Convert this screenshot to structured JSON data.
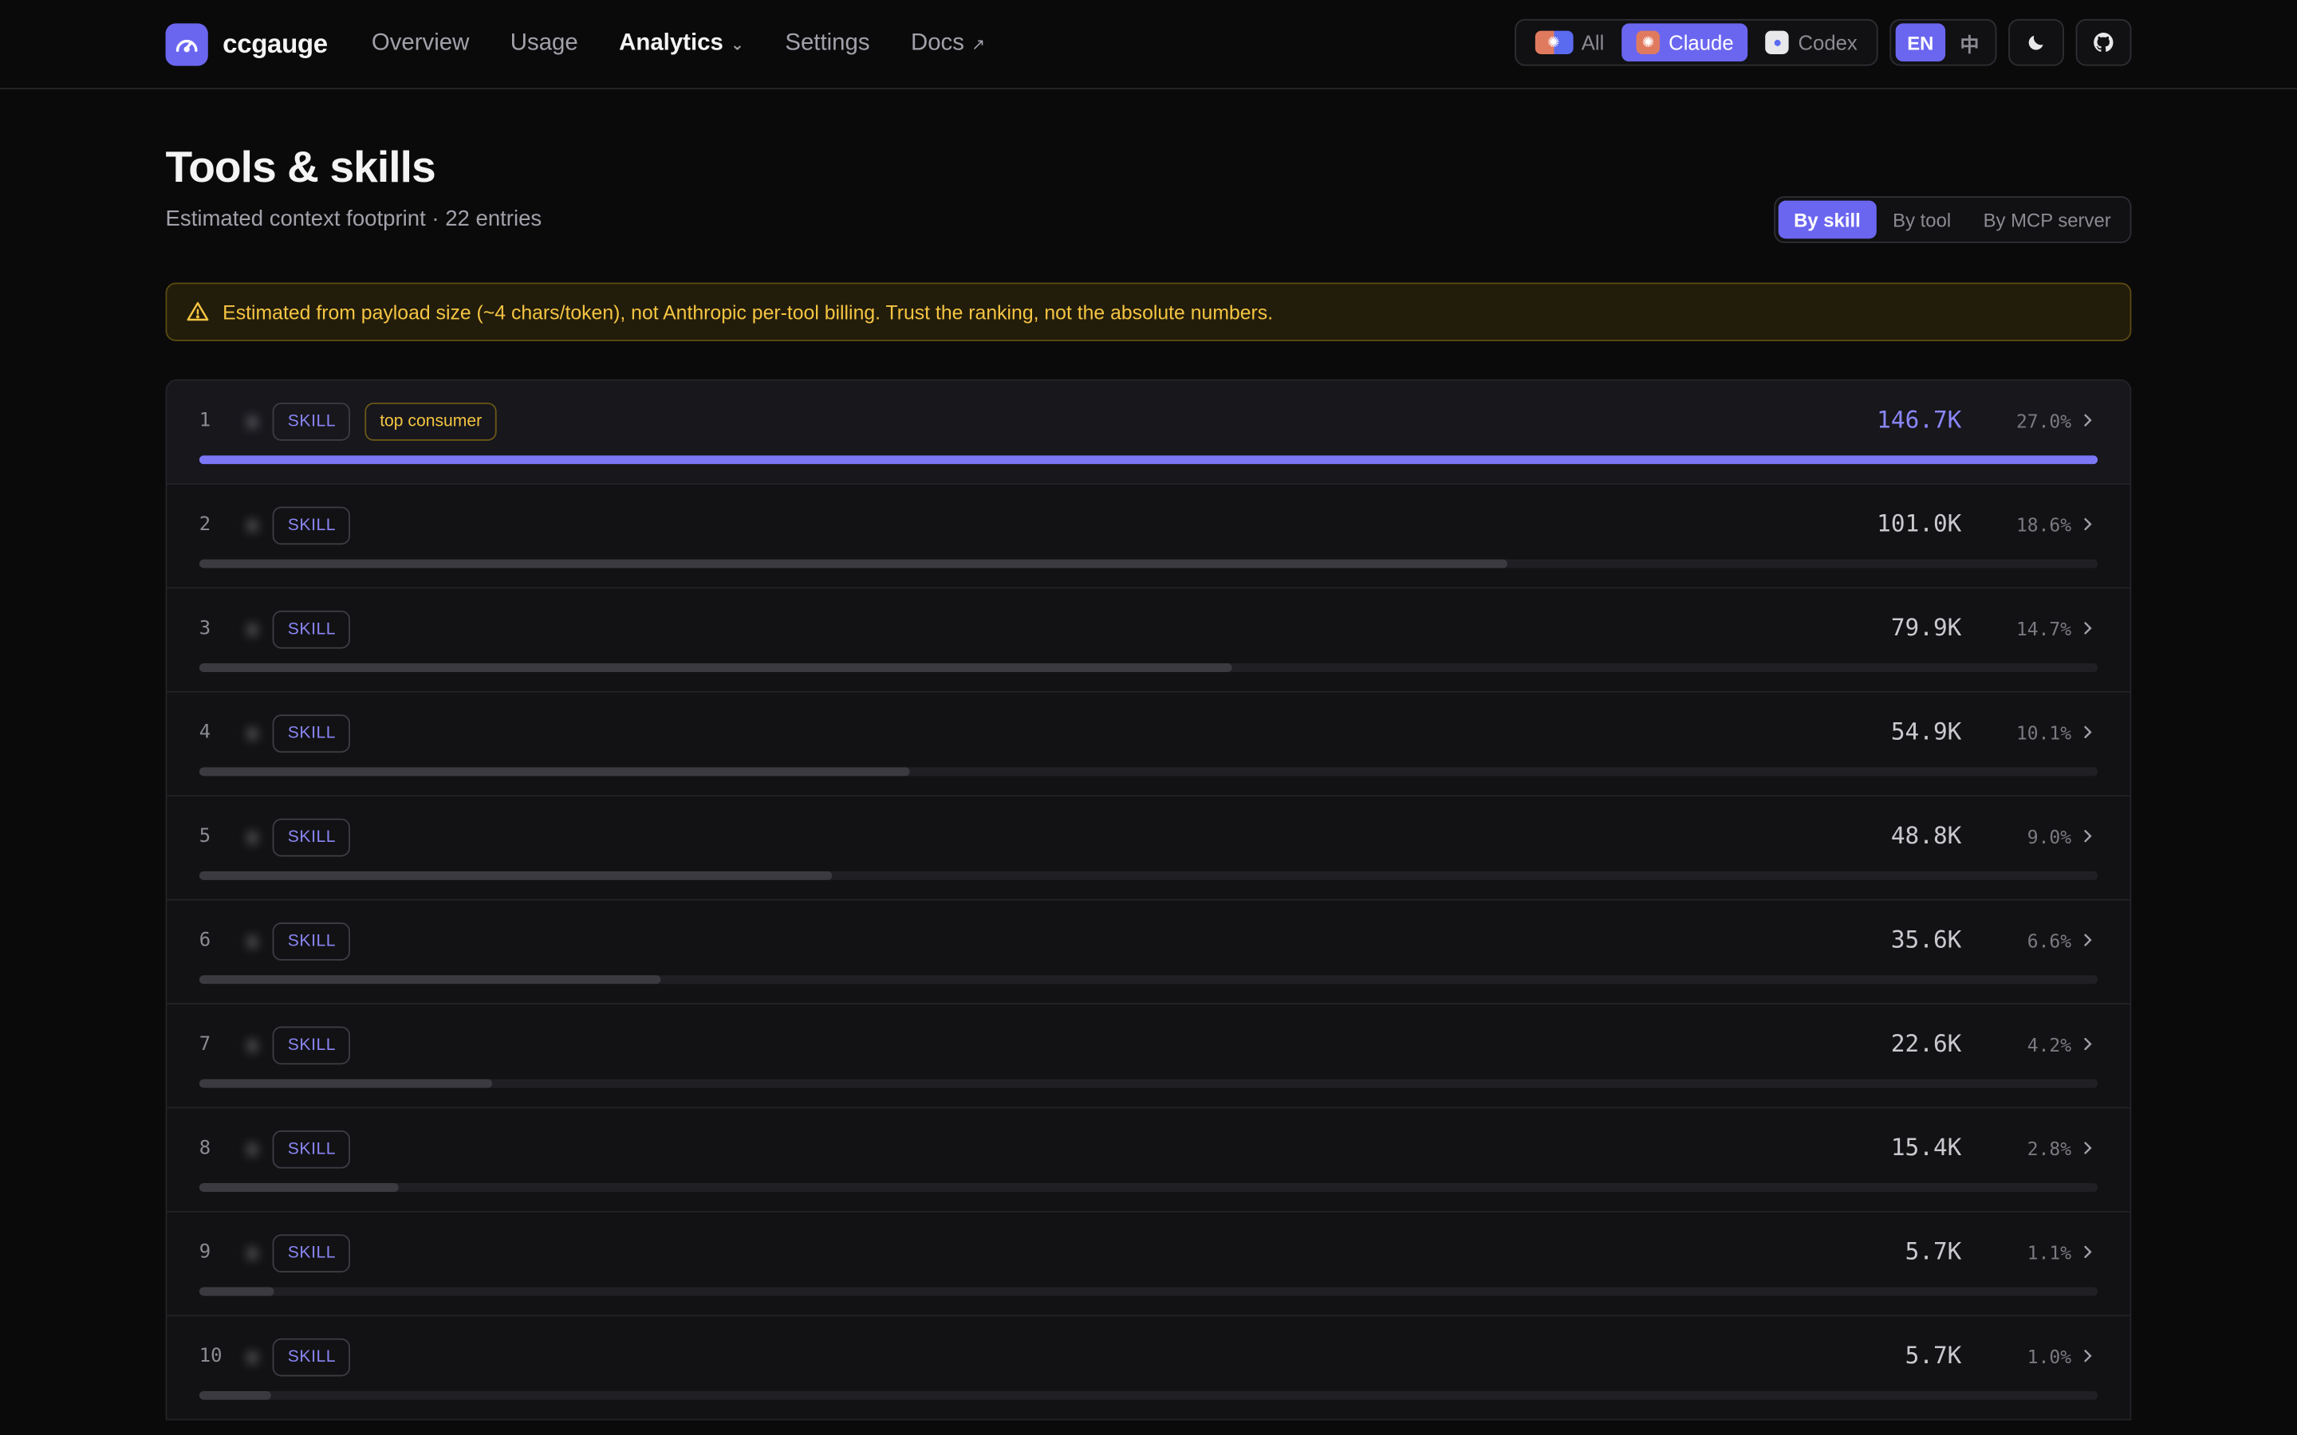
{
  "brand": {
    "name": "ccgauge"
  },
  "nav": [
    {
      "label": "Overview",
      "active": false,
      "glyph": ""
    },
    {
      "label": "Usage",
      "active": false,
      "glyph": ""
    },
    {
      "label": "Analytics",
      "active": true,
      "glyph": "⌄"
    },
    {
      "label": "Settings",
      "active": false,
      "glyph": ""
    },
    {
      "label": "Docs",
      "active": false,
      "glyph": "↗"
    }
  ],
  "source_filter": [
    {
      "label": "All",
      "icon": "all-sources-icon",
      "active": false
    },
    {
      "label": "Claude",
      "icon": "claude-icon",
      "active": true
    },
    {
      "label": "Codex",
      "icon": "codex-icon",
      "active": false
    }
  ],
  "language": [
    {
      "label": "EN",
      "active": true
    },
    {
      "label": "中",
      "active": false
    }
  ],
  "header_icons": [
    "moon-icon",
    "github-icon"
  ],
  "page": {
    "title": "Tools & skills",
    "subtitle": "Estimated context footprint · 22 entries"
  },
  "view_toggle": [
    {
      "label": "By skill",
      "active": true
    },
    {
      "label": "By tool",
      "active": false
    },
    {
      "label": "By MCP server",
      "active": false
    }
  ],
  "notice": {
    "icon": "warning-icon",
    "text": "Estimated from payload size (~4 chars/token), not Anthropic per-tool billing. Trust the ranking, not the absolute numbers."
  },
  "colors": {
    "accent": "#6b66f0",
    "warning": "#f5c542",
    "background": "#0a0a0b"
  },
  "rows": [
    {
      "rank": "1",
      "name": "x",
      "badge": "SKILL",
      "extra_badge": "top consumer",
      "tokens": "146.7K",
      "pct": "27.0%",
      "fill": 1.0
    },
    {
      "rank": "2",
      "name": "x",
      "badge": "SKILL",
      "tokens": "101.0K",
      "pct": "18.6%",
      "fill": 0.689
    },
    {
      "rank": "3",
      "name": "x",
      "badge": "SKILL",
      "tokens": "79.9K",
      "pct": "14.7%",
      "fill": 0.544
    },
    {
      "rank": "4",
      "name": "x",
      "badge": "SKILL",
      "tokens": "54.9K",
      "pct": "10.1%",
      "fill": 0.374
    },
    {
      "rank": "5",
      "name": "x",
      "badge": "SKILL",
      "tokens": "48.8K",
      "pct": "9.0%",
      "fill": 0.333
    },
    {
      "rank": "6",
      "name": "x",
      "badge": "SKILL",
      "tokens": "35.6K",
      "pct": "6.6%",
      "fill": 0.243
    },
    {
      "rank": "7",
      "name": "x",
      "badge": "SKILL",
      "tokens": "22.6K",
      "pct": "4.2%",
      "fill": 0.154
    },
    {
      "rank": "8",
      "name": "x",
      "badge": "SKILL",
      "tokens": "15.4K",
      "pct": "2.8%",
      "fill": 0.105
    },
    {
      "rank": "9",
      "name": "x",
      "badge": "SKILL",
      "tokens": "5.7K",
      "pct": "1.1%",
      "fill": 0.039
    },
    {
      "rank": "10",
      "name": "x",
      "badge": "SKILL",
      "tokens": "5.7K",
      "pct": "1.0%",
      "fill": 0.038
    }
  ]
}
